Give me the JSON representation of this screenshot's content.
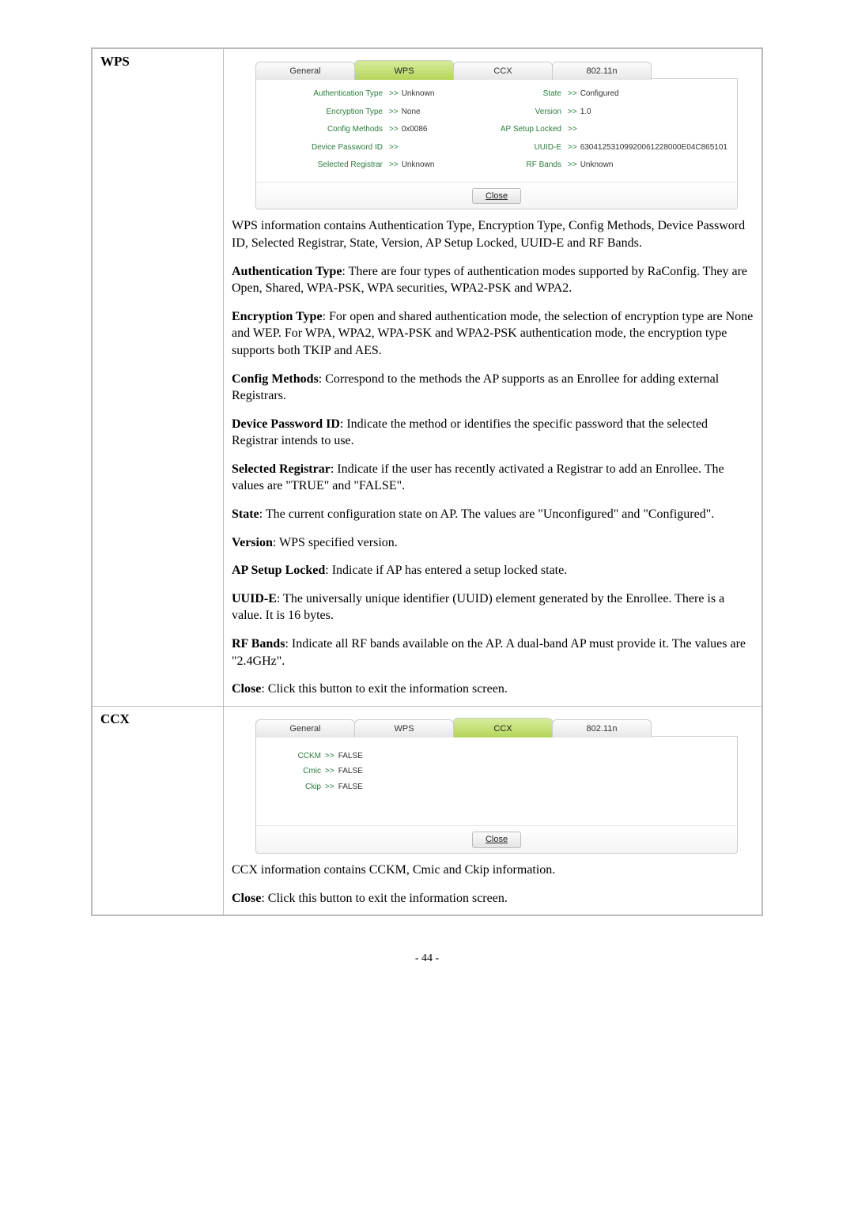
{
  "page_number": "- 44 -",
  "rows": {
    "wps": {
      "label": "WPS",
      "tabs": {
        "general": "General",
        "wps": "WPS",
        "ccx": "CCX",
        "dot11n": "802.11n"
      },
      "kv": {
        "auth_type_label": "Authentication Type",
        "auth_type_val": "Unknown",
        "enc_type_label": "Encryption Type",
        "enc_type_val": "None",
        "cfg_methods_label": "Config Methods",
        "cfg_methods_val": "0x0086",
        "dev_pw_label": "Device Password ID",
        "dev_pw_val": "",
        "sel_reg_label": "Selected Registrar",
        "sel_reg_val": "Unknown",
        "state_label": "State",
        "state_val": "Configured",
        "version_label": "Version",
        "version_val": "1.0",
        "ap_lock_label": "AP Setup Locked",
        "ap_lock_val": "",
        "uuid_label": "UUID-E",
        "uuid_val": "63041253109920061228000E04C865101",
        "rf_bands_label": "RF Bands",
        "rf_bands_val": "Unknown"
      },
      "close_label": "Close",
      "paras": {
        "intro": "WPS information contains Authentication Type, Encryption Type, Config Methods, Device Password ID, Selected Registrar, State, Version, AP Setup Locked, UUID-E and RF Bands.",
        "auth_label": "Authentication Type",
        "auth_text": ": There are four types of authentication modes supported by RaConfig. They are Open, Shared, WPA-PSK, WPA securities, WPA2-PSK and WPA2.",
        "enc_label": "Encryption Type",
        "enc_text": ": For open and shared authentication mode, the selection of encryption type are None and WEP. For WPA, WPA2, WPA-PSK and WPA2-PSK authentication mode, the encryption type supports both TKIP and AES.",
        "cfg_label": "Config Methods",
        "cfg_text": ": Correspond to the methods the AP supports as an Enrollee for adding external Registrars.",
        "devpw_label": "Device Password ID",
        "devpw_text": ": Indicate the method or identifies the specific password that the selected Registrar intends to use.",
        "selreg_label": "Selected Registrar",
        "selreg_text": ": Indicate if the user has recently activated a Registrar to add an Enrollee. The values are \"TRUE\" and \"FALSE\".",
        "state_label": "State",
        "state_text": ": The current configuration state on AP. The values are \"Unconfigured\" and \"Configured\".",
        "ver_label": "Version",
        "ver_text": ": WPS specified version.",
        "aplock_label": "AP Setup Locked",
        "aplock_text": ": Indicate if AP has entered a setup locked state.",
        "uuid_label": "UUID-E",
        "uuid_text": ": The universally unique identifier (UUID) element generated by the Enrollee. There is a value. It is 16 bytes.",
        "rfbands_label": "RF Bands",
        "rfbands_text": ": Indicate all RF bands available on the AP. A dual-band AP must provide it. The values are \"2.4GHz\".",
        "close_label": "Close",
        "close_text": ": Click this button to exit the information screen."
      }
    },
    "ccx": {
      "label": "CCX",
      "kv": {
        "cckm_label": "CCKM",
        "cckm_val": "FALSE",
        "cmic_label": "Cmic",
        "cmic_val": "FALSE",
        "ckip_label": "Ckip",
        "ckip_val": "FALSE"
      },
      "close_label": "Close",
      "paras": {
        "intro": "CCX information contains CCKM, Cmic and Ckip information.",
        "close_label": "Close",
        "close_text": ": Click this button to exit the information screen."
      }
    }
  },
  "arrow": ">>"
}
